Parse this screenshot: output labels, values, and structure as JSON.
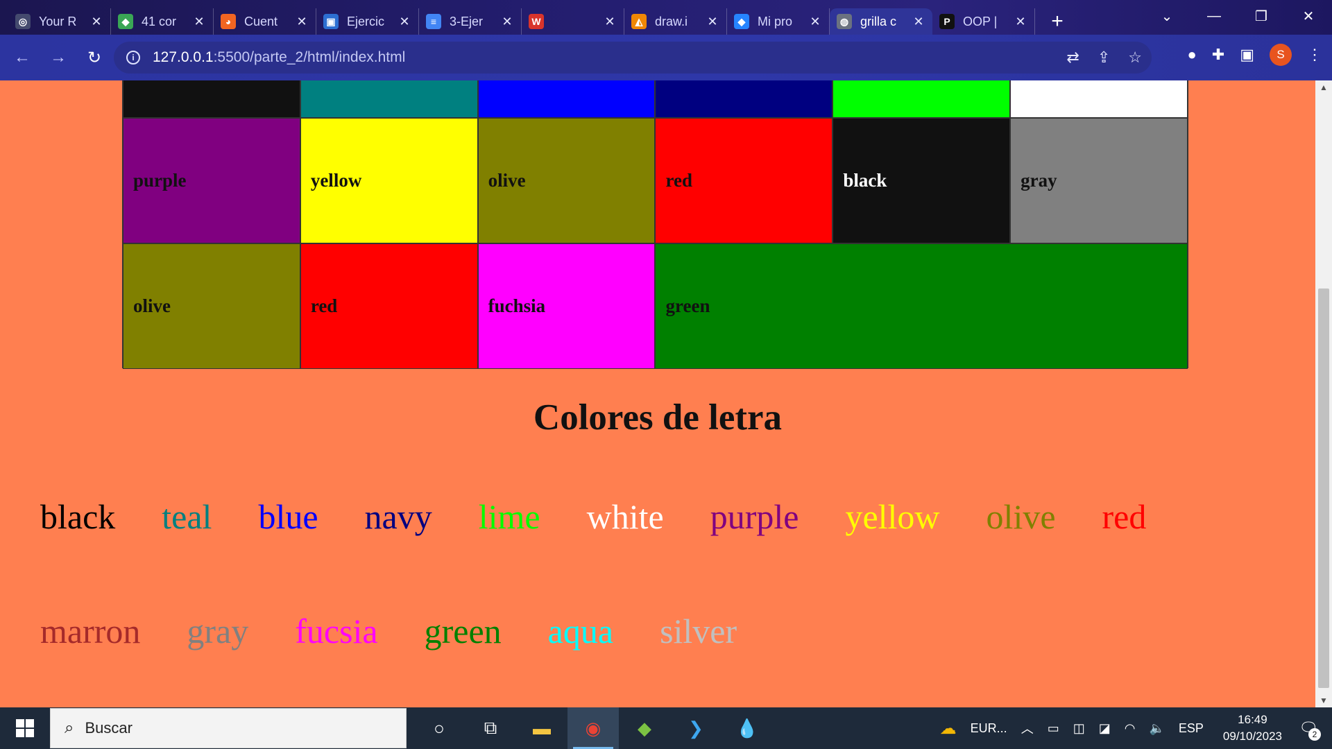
{
  "browser": {
    "tabs": [
      {
        "title": "Your R",
        "fav_color": "#444a6e",
        "fav_glyph": "◎"
      },
      {
        "title": "41 cor",
        "fav_color": "#3aa655",
        "fav_glyph": "◆"
      },
      {
        "title": "Cuent",
        "fav_color": "#f26522",
        "fav_glyph": "◕"
      },
      {
        "title": "Ejercic",
        "fav_color": "#2d6fd2",
        "fav_glyph": "▣"
      },
      {
        "title": "3-Ejer",
        "fav_color": "#4285f4",
        "fav_glyph": "≡"
      },
      {
        "title": "",
        "fav_color": "#d9342b",
        "fav_glyph": "W"
      },
      {
        "title": "draw.i",
        "fav_color": "#f08705",
        "fav_glyph": "◭"
      },
      {
        "title": "Mi pro",
        "fav_color": "#2684ff",
        "fav_glyph": "◆"
      },
      {
        "title": "grilla c",
        "fav_color": "#6b7280",
        "fav_glyph": "◍",
        "active": true
      },
      {
        "title": "OOP |",
        "fav_color": "#111111",
        "fav_glyph": "P"
      }
    ],
    "url_host": "127.0.0.1",
    "url_path": ":5500/parte_2/html/index.html",
    "avatar_letter": "S"
  },
  "grid": {
    "top_row": [
      "#111111",
      "#008080",
      "#0000ff",
      "#000080",
      "#00ff00",
      "#ffffff"
    ],
    "row2": [
      {
        "label": "purple",
        "color": "#800080"
      },
      {
        "label": "yellow",
        "color": "#ffff00"
      },
      {
        "label": "olive",
        "color": "#808000"
      },
      {
        "label": "red",
        "color": "#ff0000"
      },
      {
        "label": "black",
        "color": "#111111",
        "light": true
      },
      {
        "label": "gray",
        "color": "#808080"
      }
    ],
    "row3": [
      {
        "label": "olive",
        "color": "#808000"
      },
      {
        "label": "red",
        "color": "#ff0000"
      },
      {
        "label": "fuchsia",
        "color": "#ff00ff"
      },
      {
        "label": "green",
        "color": "#008000",
        "span": 3
      }
    ]
  },
  "section_title": "Colores de letra",
  "words_row1": [
    {
      "text": "black",
      "color": "#000000"
    },
    {
      "text": "teal",
      "color": "#008080"
    },
    {
      "text": "blue",
      "color": "#0000ff"
    },
    {
      "text": "navy",
      "color": "#000080"
    },
    {
      "text": "lime",
      "color": "#00ff00"
    },
    {
      "text": "white",
      "color": "#ffffff"
    },
    {
      "text": "purple",
      "color": "#800080"
    },
    {
      "text": "yellow",
      "color": "#ffff00"
    },
    {
      "text": "olive",
      "color": "#808000"
    },
    {
      "text": "red",
      "color": "#ff0000"
    }
  ],
  "words_row2": [
    {
      "text": "marron",
      "color": "#a52a2a"
    },
    {
      "text": "gray",
      "color": "#808080"
    },
    {
      "text": "fucsia",
      "color": "#ff00ff"
    },
    {
      "text": "green",
      "color": "#008000"
    },
    {
      "text": "aqua",
      "color": "#00ffff"
    },
    {
      "text": "silver",
      "color": "#c0c0c0"
    }
  ],
  "taskbar": {
    "search_placeholder": "Buscar",
    "weather_label": "EUR...",
    "language": "ESP",
    "time": "16:49",
    "date": "09/10/2023",
    "notification_count": "2"
  }
}
